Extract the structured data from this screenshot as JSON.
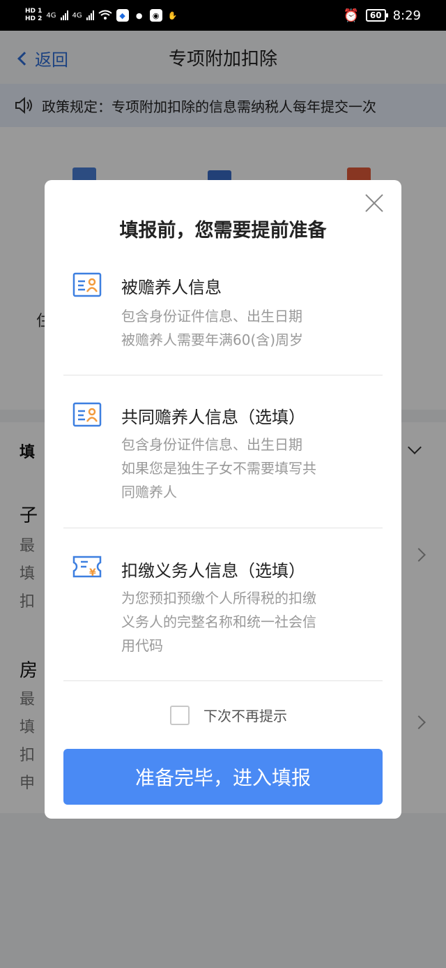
{
  "status_bar": {
    "hd1": "HD 1",
    "hd2": "HD 2",
    "net1": "4G",
    "net2": "4G",
    "battery": "60",
    "time": "8:29"
  },
  "header": {
    "back_label": "返回",
    "title": "专项附加扣除"
  },
  "notice": {
    "text": "政策规定：专项附加扣除的信息需纳税人每年提交一次"
  },
  "background": {
    "visible_chars": [
      "住",
      "填",
      "子",
      "最",
      "填",
      "扣",
      "房",
      "最",
      "填",
      "扣",
      "申"
    ]
  },
  "modal": {
    "title": "填报前，您需要提前准备",
    "items": [
      {
        "icon": "id-card-icon",
        "title": "被赡养人信息",
        "desc": [
          "包含身份证件信息、出生日期",
          "被赡养人需要年满60(含)周岁"
        ]
      },
      {
        "icon": "id-card-icon",
        "title": "共同赡养人信息（选填）",
        "desc": [
          "包含身份证件信息、出生日期",
          "如果您是独生子女不需要填写共",
          "同赡养人"
        ]
      },
      {
        "icon": "invoice-icon",
        "title": "扣缴义务人信息（选填）",
        "desc": [
          "为您预扣预缴个人所得税的扣缴",
          "义务人的完整名称和统一社会信",
          "用代码"
        ]
      }
    ],
    "checkbox_label": "下次不再提示",
    "primary_button": "准备完毕，进入填报"
  },
  "colors": {
    "accent": "#4a8af4",
    "back_link": "#2f6fd8",
    "icon_blue": "#3d7fe0",
    "icon_orange": "#f29a3c"
  }
}
